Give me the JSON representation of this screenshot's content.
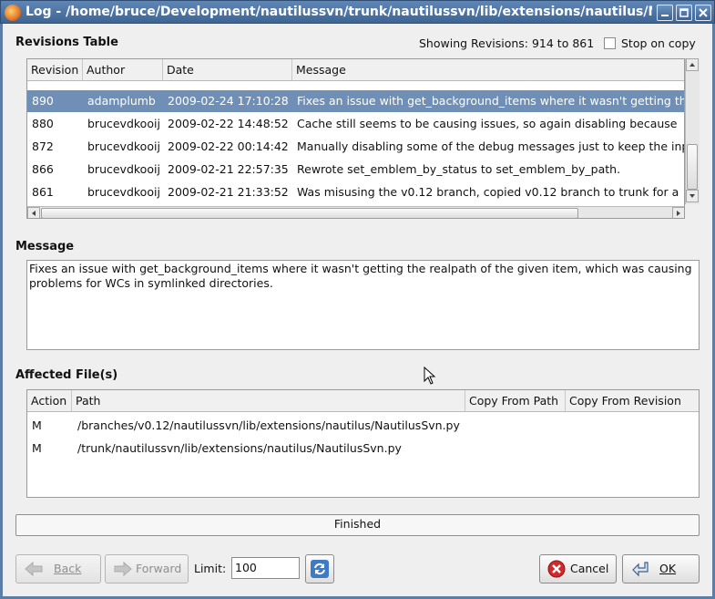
{
  "window": {
    "title": "Log - /home/bruce/Development/nautilussvn/trunk/nautilussvn/lib/extensions/nautilus/NautilusSvn.py"
  },
  "revisions": {
    "section_title": "Revisions Table",
    "showing_text": "Showing Revisions: 914 to 861",
    "stop_on_copy_label": "Stop on copy",
    "stop_on_copy_checked": false,
    "columns": [
      "Revision",
      "Author",
      "Date",
      "Message"
    ],
    "rows": [
      {
        "revision": "890",
        "author": "adamplumb",
        "date": "2009-02-24 17:10:28",
        "message": "Fixes an issue with get_background_items where it wasn't getting the realpath of the given item",
        "selected": true
      },
      {
        "revision": "880",
        "author": "brucevdkooij",
        "date": "2009-02-22 14:48:52",
        "message": "Cache still seems to be causing issues, so again disabling because",
        "selected": false
      },
      {
        "revision": "872",
        "author": "brucevdkooij",
        "date": "2009-02-22 00:14:42",
        "message": "Manually disabling some of the debug messages just to keep the input",
        "selected": false
      },
      {
        "revision": "866",
        "author": "brucevdkooij",
        "date": "2009-02-21 22:57:35",
        "message": "Rewrote set_emblem_by_status to set_emblem_by_path.",
        "selected": false
      },
      {
        "revision": "861",
        "author": "brucevdkooij",
        "date": "2009-02-21 21:33:52",
        "message": "Was misusing the v0.12 branch, copied v0.12 branch to trunk for a",
        "selected": false
      }
    ]
  },
  "message": {
    "section_title": "Message",
    "text": "Fixes an issue with get_background_items where it wasn't getting the realpath of the given item, which was causing problems for WCs in symlinked directories."
  },
  "affected_files": {
    "section_title": "Affected File(s)",
    "columns": [
      "Action",
      "Path",
      "Copy From Path",
      "Copy From Revision"
    ],
    "rows": [
      {
        "action": "M",
        "path": "/branches/v0.12/nautilussvn/lib/extensions/nautilus/NautilusSvn.py",
        "copy_from_path": "",
        "copy_from_revision": ""
      },
      {
        "action": "M",
        "path": "/trunk/nautilussvn/lib/extensions/nautilus/NautilusSvn.py",
        "copy_from_path": "",
        "copy_from_revision": ""
      }
    ]
  },
  "status": {
    "text": "Finished"
  },
  "footer": {
    "back_label": "Back",
    "forward_label": "Forward",
    "limit_label": "Limit:",
    "limit_value": "100",
    "cancel_label": "Cancel",
    "ok_label": "OK"
  },
  "icons": {
    "app": "nautilussvn-app-icon",
    "refresh": "refresh-icon",
    "cancel": "cancel-red-x-icon",
    "ok": "ok-return-arrow-icon",
    "back": "back-arrow-icon",
    "forward": "forward-arrow-icon"
  },
  "colors": {
    "titlebar": "#4a71a3",
    "selection": "#6f8fb6",
    "window_bg": "#efefef"
  }
}
